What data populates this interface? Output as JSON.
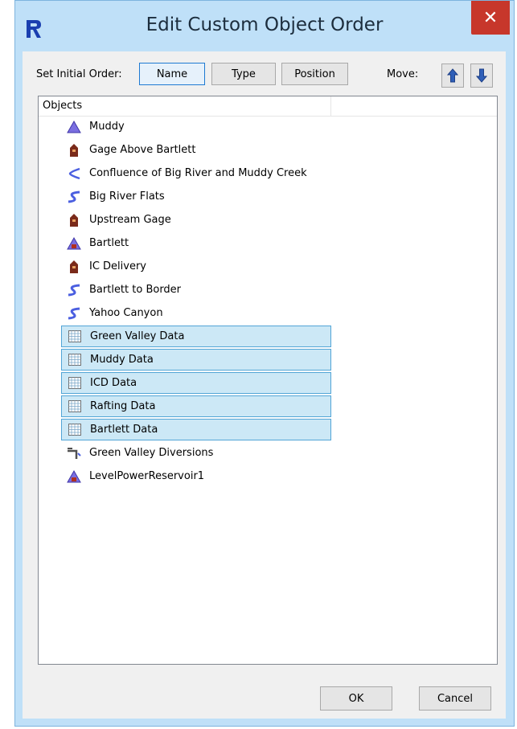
{
  "window": {
    "title": "Edit Custom Object Order",
    "close_label": "✕",
    "app_icon": "riverware-r-icon"
  },
  "order": {
    "label": "Set Initial Order:",
    "buttons": [
      "Name",
      "Type",
      "Position"
    ],
    "active": "Name"
  },
  "move": {
    "label": "Move:",
    "up_icon": "arrow-up-icon",
    "down_icon": "arrow-down-icon"
  },
  "list": {
    "header": "Objects",
    "items": [
      {
        "label": "Muddy",
        "icon": "reservoir-icon",
        "selected": false
      },
      {
        "label": "Gage Above Bartlett",
        "icon": "gage-icon",
        "selected": false
      },
      {
        "label": "Confluence of Big River and Muddy Creek",
        "icon": "confluence-icon",
        "selected": false
      },
      {
        "label": "Big River Flats",
        "icon": "reach-icon",
        "selected": false
      },
      {
        "label": "Upstream Gage",
        "icon": "gage-icon",
        "selected": false
      },
      {
        "label": "Bartlett",
        "icon": "power-reservoir-icon",
        "selected": false
      },
      {
        "label": "IC Delivery",
        "icon": "gage-icon",
        "selected": false
      },
      {
        "label": "Bartlett to Border",
        "icon": "reach-icon",
        "selected": false
      },
      {
        "label": "Yahoo Canyon",
        "icon": "reach-icon",
        "selected": false
      },
      {
        "label": "Green Valley Data",
        "icon": "data-object-icon",
        "selected": true
      },
      {
        "label": "Muddy Data",
        "icon": "data-object-icon",
        "selected": true
      },
      {
        "label": "ICD Data",
        "icon": "data-object-icon",
        "selected": true
      },
      {
        "label": "Rafting Data",
        "icon": "data-object-icon",
        "selected": true
      },
      {
        "label": "Bartlett Data",
        "icon": "data-object-icon",
        "selected": true
      },
      {
        "label": "Green Valley Diversions",
        "icon": "diversion-icon",
        "selected": false
      },
      {
        "label": "LevelPowerReservoir1",
        "icon": "power-reservoir-icon",
        "selected": false
      }
    ]
  },
  "footer": {
    "ok_label": "OK",
    "cancel_label": "Cancel"
  },
  "colors": {
    "accent": "#1e7ad2",
    "selection": "#cce8f6",
    "close": "#c7372b"
  }
}
